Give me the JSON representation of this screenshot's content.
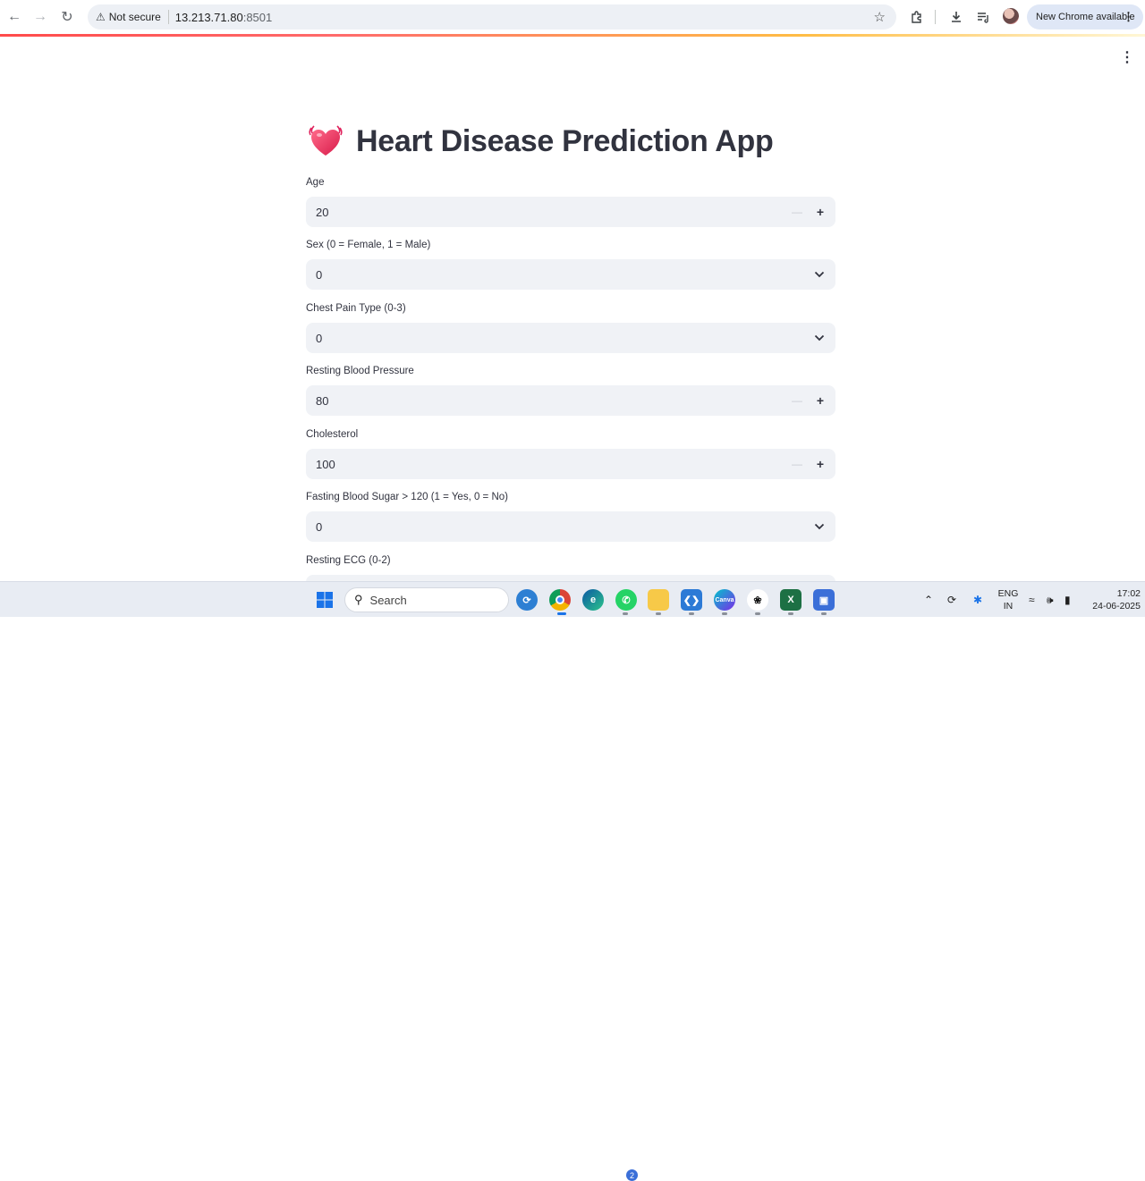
{
  "browser": {
    "security_label": "Not secure",
    "url_host": "13.213.71.80",
    "url_port": ":8501",
    "update_button": "New Chrome available"
  },
  "app": {
    "title": "Heart Disease Prediction App",
    "fields": [
      {
        "label": "Age",
        "value": "20",
        "type": "number"
      },
      {
        "label": "Sex (0 = Female, 1 = Male)",
        "value": "0",
        "type": "select"
      },
      {
        "label": "Chest Pain Type (0-3)",
        "value": "0",
        "type": "select"
      },
      {
        "label": "Resting Blood Pressure",
        "value": "80",
        "type": "number"
      },
      {
        "label": "Cholesterol",
        "value": "100",
        "type": "number"
      },
      {
        "label": "Fasting Blood Sugar > 120 (1 = Yes, 0 = No)",
        "value": "0",
        "type": "select"
      },
      {
        "label": "Resting ECG (0-2)",
        "value": "",
        "type": "select"
      }
    ]
  },
  "taskbar": {
    "search_placeholder": "Search",
    "whatsapp_badge": "2",
    "lang_line1": "ENG",
    "lang_line2": "IN",
    "time": "17:02",
    "date": "24-06-2025"
  },
  "colors": {
    "text": "#31333f",
    "input_bg": "#f0f2f6",
    "accent": "#ff4b4b"
  }
}
